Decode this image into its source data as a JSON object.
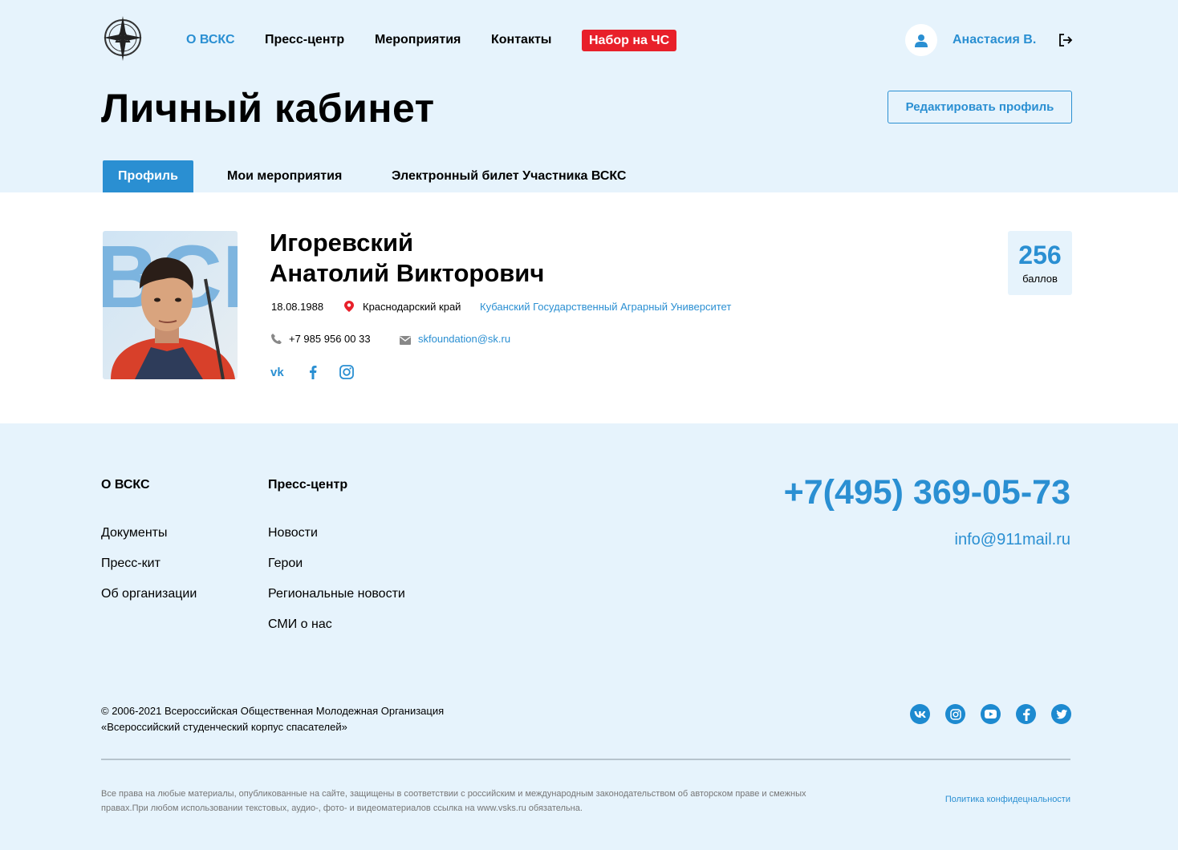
{
  "header": {
    "nav": [
      "О ВСКС",
      "Пресс-центр",
      "Мероприятия",
      "Контакты"
    ],
    "badge": "Набор на ЧС",
    "user_name": "Анастасия В."
  },
  "page": {
    "title": "Личный кабинет",
    "edit_button": "Редактировать профиль"
  },
  "tabs": [
    "Профиль",
    "Мои мероприятия",
    "Электронный билет Участника ВСКС"
  ],
  "profile": {
    "last_name": "Игоревский",
    "first_middle": "Анатолий Викторович",
    "birth_date": "18.08.1988",
    "region": "Краснодарский край",
    "university": "Кубанский Государственный Аграрный Университет",
    "phone": "+7 985 956 00 33",
    "email": "skfoundation@sk.ru",
    "score": "256",
    "score_label": "баллов",
    "socials": [
      "vk-icon",
      "facebook-icon",
      "instagram-icon"
    ]
  },
  "footer": {
    "col1": {
      "title": "О ВСКС",
      "links": [
        "Документы",
        "Пресс-кит",
        "Об организации"
      ]
    },
    "col2": {
      "title": "Пресс-центр",
      "links": [
        "Новости",
        "Герои",
        "Региональные новости",
        "СМИ о нас"
      ]
    },
    "phone": "+7(495) 369-05-73",
    "email": "info@911mail.ru",
    "copyright_line1": "© 2006-2021 Всероссийская Общественная Молодежная Организация",
    "copyright_line2": "«Всероссийский студенческий корпус спасателей»",
    "socials": [
      "vk-icon",
      "instagram-icon",
      "youtube-icon",
      "facebook-icon",
      "twitter-icon"
    ],
    "legal": "Все права на любые материалы, опубликованные на сайте, защищены в соответствии с российским и международным законодательством об авторском праве и смежных правах.При любом использовании текстовых, аудио-, фото- и видеоматериалов ссылка на www.vsks.ru обязательна.",
    "privacy": "Политика конфидецнальности"
  },
  "colors": {
    "accent": "#2a8fd2",
    "badge": "#e8202a",
    "background": "#e6f3fc"
  }
}
